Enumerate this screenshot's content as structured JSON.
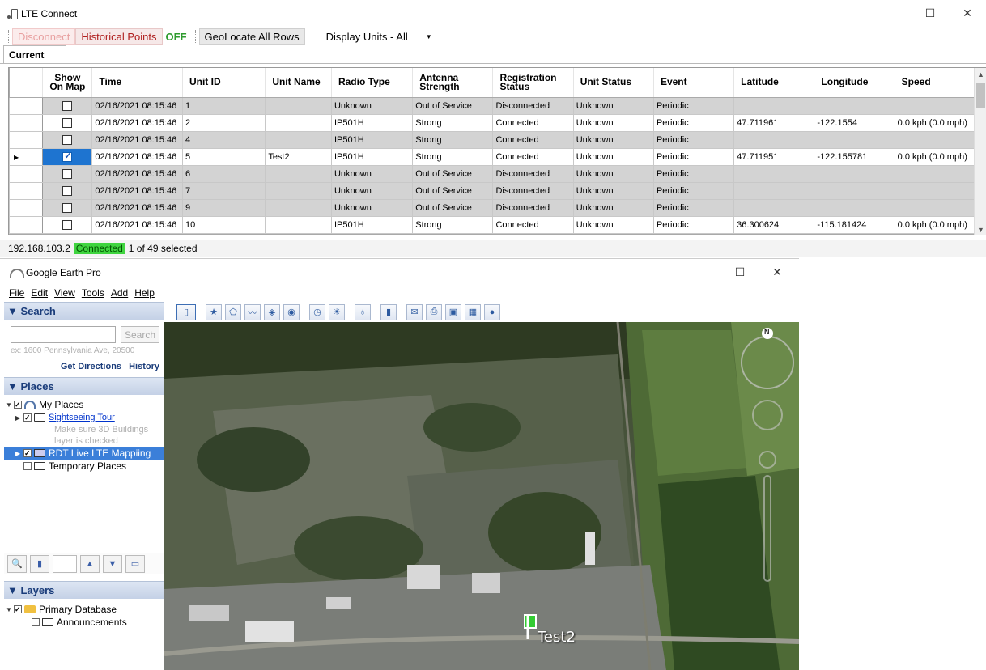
{
  "lte": {
    "title": "LTE Connect",
    "window_controls": {
      "minimize": "—",
      "maximize": "☐",
      "close": "✕"
    },
    "toolbar": {
      "disconnect": "Disconnect",
      "historical_points": "Historical Points",
      "historical_state": "OFF",
      "geolocate": "GeoLocate All Rows",
      "display_units": "Display Units - All"
    },
    "tab": "Current",
    "columns": [
      "Show On Map",
      "Time",
      "Unit ID",
      "Unit Name",
      "Radio Type",
      "Antenna Strength",
      "Registration Status",
      "Unit Status",
      "Event",
      "Latitude",
      "Longitude",
      "Speed"
    ],
    "rows": [
      {
        "checked": false,
        "time": "02/16/2021  08:15:46",
        "unit_id": "1",
        "unit_name": "",
        "radio": "Unknown",
        "antenna": "Out of Service",
        "reg": "Disconnected",
        "status": "Unknown",
        "event": "Periodic",
        "lat": "",
        "lon": "",
        "speed": "",
        "shade": "gray",
        "current": false
      },
      {
        "checked": false,
        "time": "02/16/2021  08:15:46",
        "unit_id": "2",
        "unit_name": "",
        "radio": "IP501H",
        "antenna": "Strong",
        "reg": "Connected",
        "status": "Unknown",
        "event": "Periodic",
        "lat": "47.711961",
        "lon": "-122.1554",
        "speed": "0.0 kph (0.0 mph)",
        "shade": "white",
        "current": false
      },
      {
        "checked": false,
        "time": "02/16/2021  08:15:46",
        "unit_id": "4",
        "unit_name": "",
        "radio": "IP501H",
        "antenna": "Strong",
        "reg": "Connected",
        "status": "Unknown",
        "event": "Periodic",
        "lat": "",
        "lon": "",
        "speed": "",
        "shade": "gray",
        "current": false
      },
      {
        "checked": true,
        "time": "02/16/2021  08:15:46",
        "unit_id": "5",
        "unit_name": "Test2",
        "radio": "IP501H",
        "antenna": "Strong",
        "reg": "Connected",
        "status": "Unknown",
        "event": "Periodic",
        "lat": "47.711951",
        "lon": "-122.155781",
        "speed": "0.0 kph (0.0 mph)",
        "shade": "white",
        "current": true
      },
      {
        "checked": false,
        "time": "02/16/2021  08:15:46",
        "unit_id": "6",
        "unit_name": "",
        "radio": "Unknown",
        "antenna": "Out of Service",
        "reg": "Disconnected",
        "status": "Unknown",
        "event": "Periodic",
        "lat": "",
        "lon": "",
        "speed": "",
        "shade": "gray",
        "current": false
      },
      {
        "checked": false,
        "time": "02/16/2021  08:15:46",
        "unit_id": "7",
        "unit_name": "",
        "radio": "Unknown",
        "antenna": "Out of Service",
        "reg": "Disconnected",
        "status": "Unknown",
        "event": "Periodic",
        "lat": "",
        "lon": "",
        "speed": "",
        "shade": "gray",
        "current": false
      },
      {
        "checked": false,
        "time": "02/16/2021  08:15:46",
        "unit_id": "9",
        "unit_name": "",
        "radio": "Unknown",
        "antenna": "Out of Service",
        "reg": "Disconnected",
        "status": "Unknown",
        "event": "Periodic",
        "lat": "",
        "lon": "",
        "speed": "",
        "shade": "gray",
        "current": false
      },
      {
        "checked": false,
        "time": "02/16/2021  08:15:46",
        "unit_id": "10",
        "unit_name": "",
        "radio": "IP501H",
        "antenna": "Strong",
        "reg": "Connected",
        "status": "Unknown",
        "event": "Periodic",
        "lat": "36.300624",
        "lon": "-115.181424",
        "speed": "0.0 kph (0.0 mph)",
        "shade": "white",
        "current": false
      }
    ],
    "status": {
      "ip": "192.168.103.2",
      "connection": "Connected",
      "selection": "1 of 49 selected"
    }
  },
  "ge": {
    "title": "Google Earth Pro",
    "window_controls": {
      "minimize": "—",
      "maximize": "☐",
      "close": "✕"
    },
    "menu": [
      "File",
      "Edit",
      "View",
      "Tools",
      "Add",
      "Help"
    ],
    "search": {
      "header": "▼ Search",
      "button": "Search",
      "hint": "ex: 1600 Pennsylvania Ave, 20500",
      "get_directions": "Get Directions",
      "history": "History"
    },
    "places": {
      "header": "▼ Places",
      "my_places": "My Places",
      "sightseeing": "Sightseeing Tour",
      "sightseeing_note_1": "Make sure 3D Buildings",
      "sightseeing_note_2": "layer is checked",
      "rdt": "RDT Live LTE Mappiing",
      "temporary": "Temporary Places"
    },
    "layers": {
      "header": "▼ Layers",
      "primary": "Primary Database",
      "announcements": "Announcements"
    },
    "map": {
      "placemark": "Test2",
      "compass_north": "N"
    }
  }
}
